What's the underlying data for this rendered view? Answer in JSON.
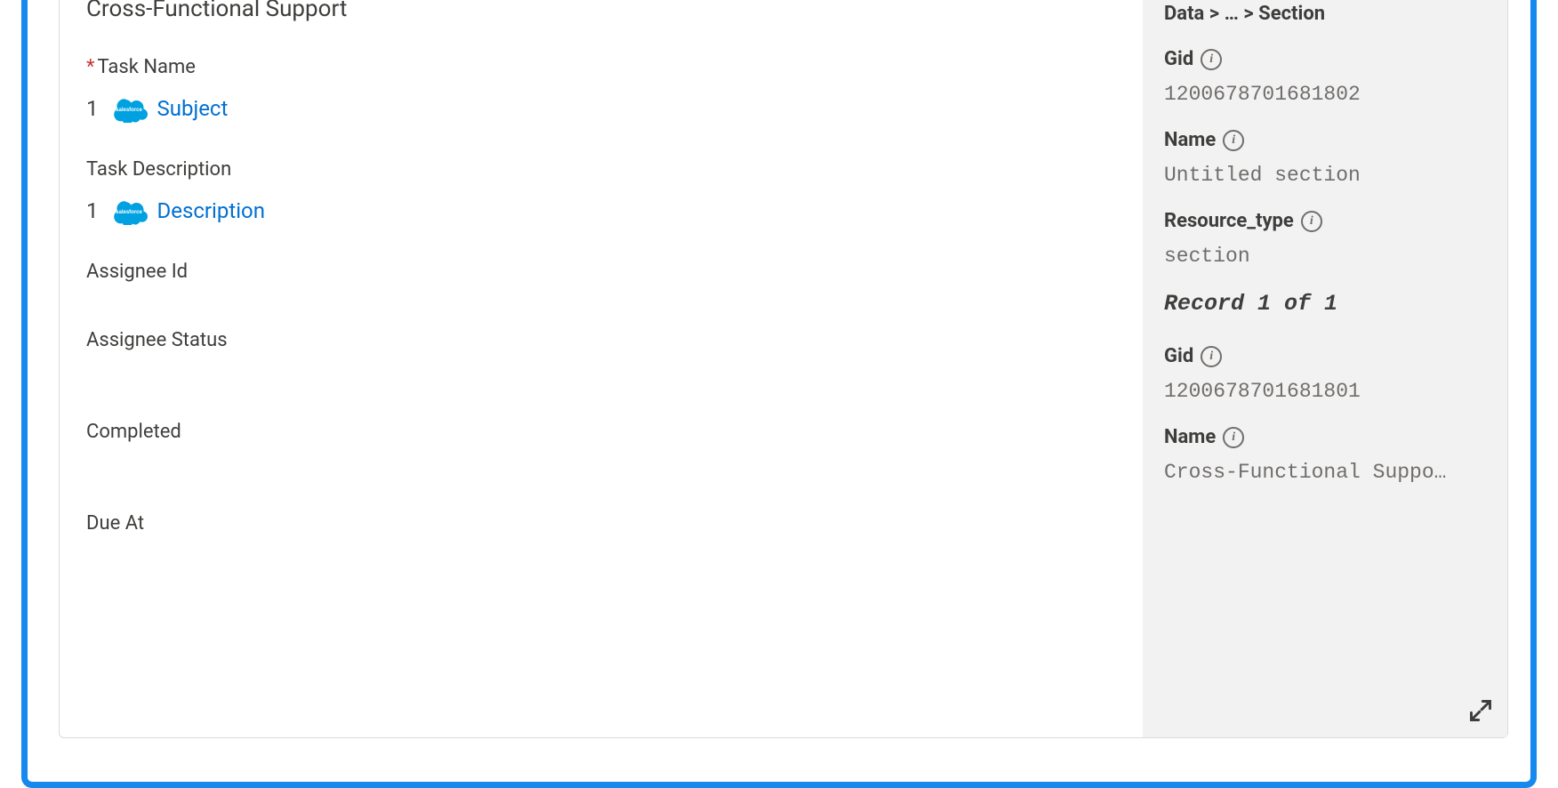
{
  "main": {
    "section_title": "Cross-Functional Support",
    "fields": [
      {
        "label": "Task Name",
        "required": true,
        "index": "1",
        "link": "Subject"
      },
      {
        "label": "Task Description",
        "required": false,
        "index": "1",
        "link": "Description"
      },
      {
        "label": "Assignee Id",
        "required": false
      },
      {
        "label": "Assignee Status",
        "required": false
      },
      {
        "label": "Completed",
        "required": false
      },
      {
        "label": "Due At",
        "required": false
      }
    ]
  },
  "sidebar": {
    "breadcrumb": "Data > … > Section",
    "records": [
      {
        "fields": [
          {
            "label": "Gid",
            "value": "1200678701681802"
          },
          {
            "label": "Name",
            "value": "Untitled section"
          },
          {
            "label": "Resource_type",
            "value": "section"
          }
        ]
      },
      {
        "indicator": "Record 1 of 1",
        "fields": [
          {
            "label": "Gid",
            "value": "1200678701681801"
          },
          {
            "label": "Name",
            "value": "Cross-Functional Suppo…"
          }
        ]
      }
    ]
  }
}
